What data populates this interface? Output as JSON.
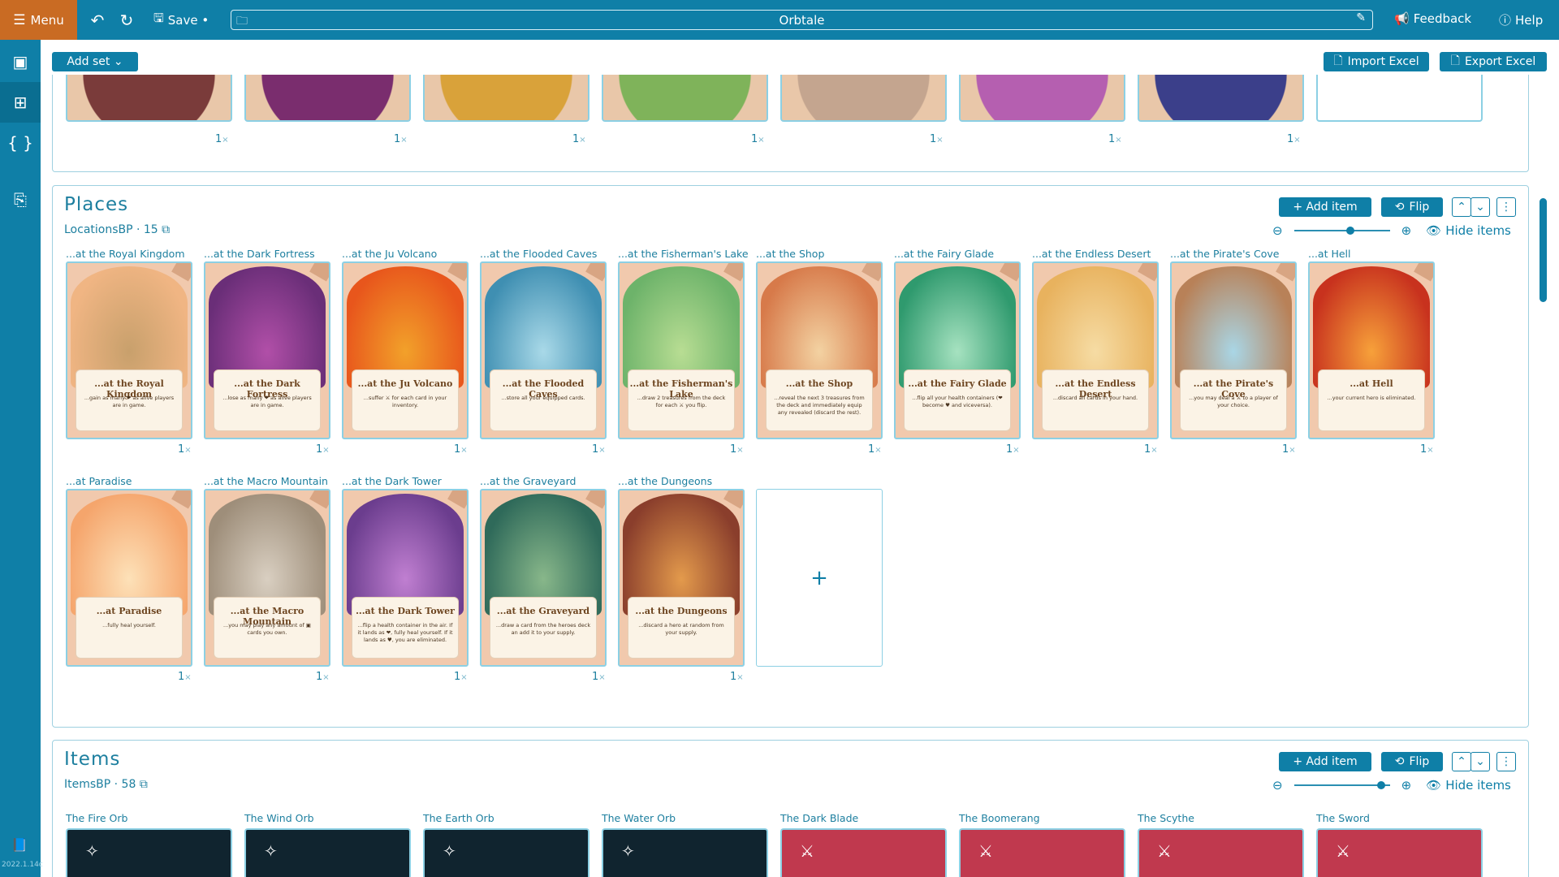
{
  "topbar": {
    "menu_label": "Menu",
    "save_label": "Save •",
    "project_title": "Orbtale",
    "feedback_label": "Feedback",
    "help_label": "Help"
  },
  "rail": {
    "version": "2022.1.14c"
  },
  "subtoolbar": {
    "add_set_label": "Add set ⌄",
    "import_label": "Import Excel",
    "export_label": "Export Excel"
  },
  "top_set": {
    "counts": [
      "1",
      "1",
      "1",
      "1",
      "1",
      "1",
      "1"
    ],
    "arts": [
      "#7a3b3a",
      "#7a2d6e",
      "#d9a23a",
      "#7fb35a",
      "#c4a58f",
      "#b55fb0",
      "#3b3f8a"
    ]
  },
  "places": {
    "title": "Places",
    "subtitle": "LocationsBP · 15",
    "add_item_label": "+ Add item",
    "flip_label": "Flip",
    "hide_items_label": "Hide items",
    "zoom_level": 0.6,
    "cards": [
      {
        "label": "...at the Royal Kingdom",
        "title": "...at the Royal Kingdom",
        "text": "...gain as many ❤ as alive players are in game.",
        "count": "1",
        "art": "#f0b583",
        "art2": "#c8a06c"
      },
      {
        "label": "...at the Dark Fortress",
        "title": "...at the Dark Fortress",
        "text": "...lose as many ❤ as alive players are in game.",
        "count": "1",
        "art": "#6a2e78",
        "art2": "#b14fa8"
      },
      {
        "label": "...at the Ju Volcano",
        "title": "...at the Ju Volcano",
        "text": "...suffer ⚔ for each card in your inventory.",
        "count": "1",
        "art": "#e8561c",
        "art2": "#f2a12a"
      },
      {
        "label": "...at the Flooded Caves",
        "title": "...at the Flooded Caves",
        "text": "...store all your equipped cards.",
        "count": "1",
        "art": "#3f8fb2",
        "art2": "#a9d9e8"
      },
      {
        "label": "...at the Fisherman's Lake",
        "title": "...at the Fisherman's Lake",
        "text": "...draw 2 treasures from the deck for each ⚔ you flip.",
        "count": "1",
        "art": "#6db36a",
        "art2": "#b8dd93"
      },
      {
        "label": "...at the Shop",
        "title": "...at the Shop",
        "text": "...reveal the next 3 treasures from the deck and immediately equip any revealed (discard the rest).",
        "count": "1",
        "art": "#d77a4a",
        "art2": "#f3d2a2"
      },
      {
        "label": "...at the Fairy Glade",
        "title": "...at the Fairy Glade",
        "text": "...flip all your health containers (❤ become ♥ and viceversa).",
        "count": "1",
        "art": "#2f9a6e",
        "art2": "#a6e2c0"
      },
      {
        "label": "...at the Endless Desert",
        "title": "...at the Endless Desert",
        "text": "...discard all cards in your hand.",
        "count": "1",
        "art": "#e8b25e",
        "art2": "#f6dca4"
      },
      {
        "label": "...at the Pirate's Cove",
        "title": "...at the Pirate's Cove",
        "text": "...you may deal a ⚔ to a player of your choice.",
        "count": "1",
        "art": "#b88158",
        "art2": "#a9d6e6"
      },
      {
        "label": "...at Hell",
        "title": "...at Hell",
        "text": "...your current hero is eliminated.",
        "count": "1",
        "art": "#c8321e",
        "art2": "#f7a13a"
      },
      {
        "label": "...at Paradise",
        "title": "...at Paradise",
        "text": "...fully heal yourself.",
        "count": "1",
        "art": "#f5a56c",
        "art2": "#fde1b8"
      },
      {
        "label": "...at the Macro Mountain",
        "title": "...at the Macro Mountain",
        "text": "...you may play any amount of ▣ cards you own.",
        "count": "1",
        "art": "#9e8e7a",
        "art2": "#d9cfc1"
      },
      {
        "label": "...at the Dark Tower",
        "title": "...at the Dark Tower",
        "text": "...flip a health container in the air. If it lands as ❤, fully heal yourself. If it lands as ♥, you are eliminated.",
        "count": "1",
        "art": "#6b3d8e",
        "art2": "#c07fd1"
      },
      {
        "label": "...at the Graveyard",
        "title": "...at the Graveyard",
        "text": "...draw a card from the heroes deck an add it to your supply.",
        "count": "1",
        "art": "#2f6a5a",
        "art2": "#88b78a"
      },
      {
        "label": "...at the Dungeons",
        "title": "...at the Dungeons",
        "text": "...discard a hero at random from your supply.",
        "count": "1",
        "art": "#8a3e2c",
        "art2": "#e39a4c"
      }
    ]
  },
  "items": {
    "title": "Items",
    "subtitle": "ItemsBP · 58",
    "add_item_label": "+ Add item",
    "flip_label": "Flip",
    "hide_items_label": "Hide items",
    "zoom_level": 0.95,
    "cards": [
      {
        "label": "The Fire Orb",
        "art": "#10242f"
      },
      {
        "label": "The Wind Orb",
        "art": "#10242f"
      },
      {
        "label": "The Earth Orb",
        "art": "#10242f"
      },
      {
        "label": "The Water Orb",
        "art": "#10242f"
      },
      {
        "label": "The Dark Blade",
        "art": "#c0394e"
      },
      {
        "label": "The Boomerang",
        "art": "#c0394e"
      },
      {
        "label": "The Scythe",
        "art": "#c0394e"
      },
      {
        "label": "The Sword",
        "art": "#c0394e"
      }
    ]
  },
  "colors": {
    "brand": "#0f7fa7",
    "menu": "#c96b23"
  }
}
